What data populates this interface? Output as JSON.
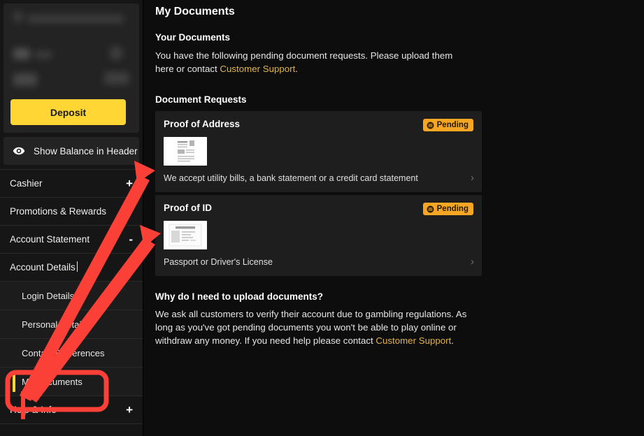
{
  "sidebar": {
    "balance_panel": {
      "redacted": true
    },
    "deposit_label": "Deposit",
    "show_balance_label": "Show Balance in Header",
    "nav_items": [
      {
        "label": "Cashier",
        "toggle": "+"
      },
      {
        "label": "Promotions & Rewards",
        "toggle": "+"
      },
      {
        "label": "Account Statement",
        "toggle": "-"
      },
      {
        "label": "Account Details",
        "toggle": "−"
      }
    ],
    "sub_items": [
      {
        "label": "Login Details",
        "active": false
      },
      {
        "label": "Personal Details",
        "active": false
      },
      {
        "label": "Contact Preferences",
        "active": false
      },
      {
        "label": "My Documents",
        "active": true
      }
    ],
    "help_item": {
      "label": "Help & Info",
      "toggle": "+"
    }
  },
  "main": {
    "page_title": "My Documents",
    "your_documents_heading": "Your Documents",
    "intro_text_before": "You have the following pending document requests. Please upload them here or contact ",
    "intro_link": "Customer Support",
    "intro_text_after": ".",
    "document_requests_heading": "Document Requests",
    "cards": [
      {
        "title": "Proof of Address",
        "status": "Pending",
        "description": "We accept utility bills, a bank statement or a credit card statement",
        "thumbnail": "document-thumbnail",
        "chevron": "›"
      },
      {
        "title": "Proof of ID",
        "status": "Pending",
        "description": "Passport or Driver's License",
        "thumbnail": "id-card-thumbnail",
        "chevron": "›"
      }
    ],
    "why_heading": "Why do I need to upload documents?",
    "why_text_before": "We ask all customers to verify their account due to gambling regulations. As long as you've got pending documents you won't be able to play online or withdraw any money. If you need help please contact ",
    "why_link": "Customer Support",
    "why_text_after": "."
  },
  "colors": {
    "accent_yellow": "#ffd633",
    "link_gold": "#e0b34a",
    "badge_orange": "#f5a623",
    "annotation_red": "#ff3b30",
    "page_bg": "#0d0d0d",
    "card_bg": "#1e1e1e",
    "sidebar_bg": "#151515"
  },
  "annotations": {
    "highlight_target": "My Documents",
    "arrow_count": 2
  }
}
